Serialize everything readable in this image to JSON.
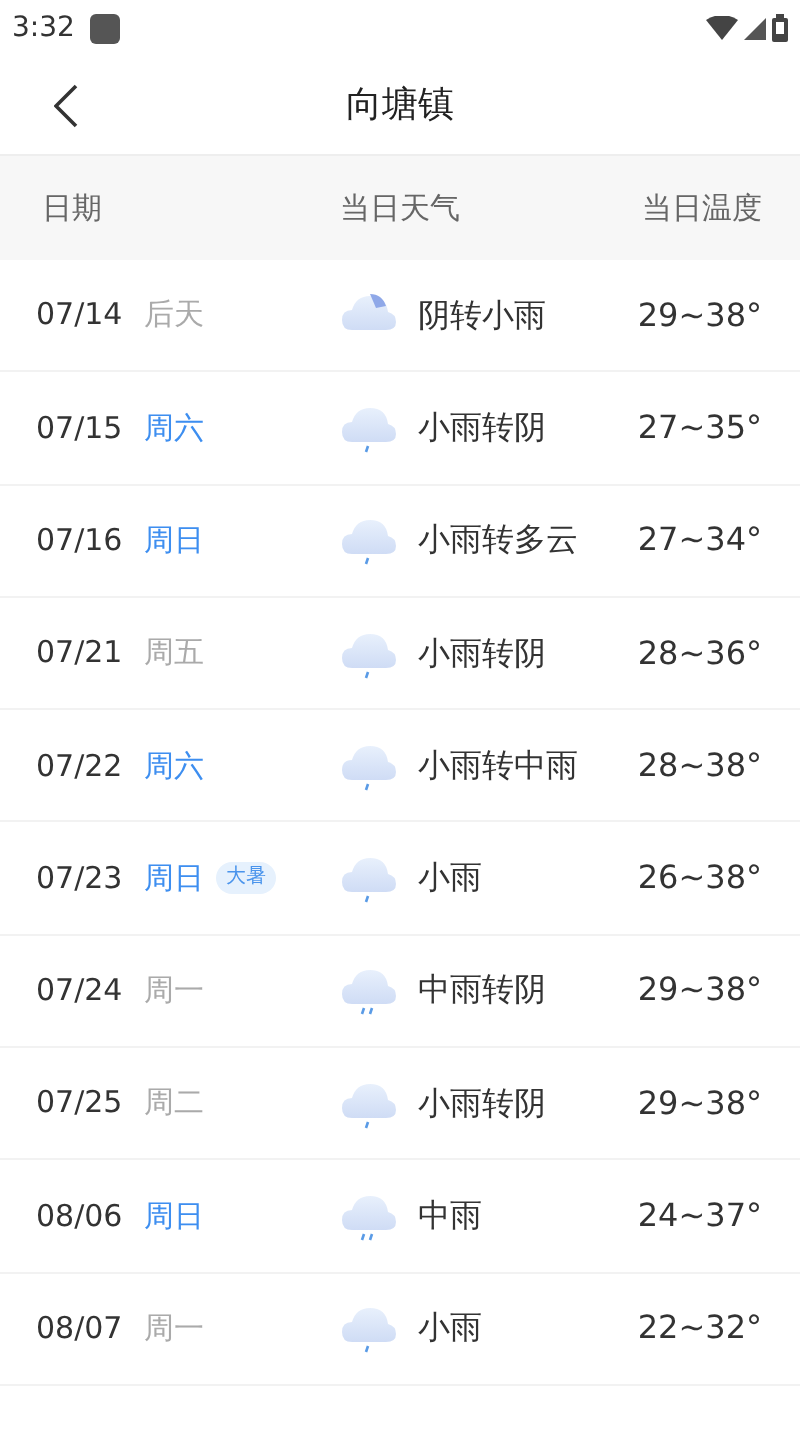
{
  "status_bar": {
    "time": "3:32"
  },
  "title_bar": {
    "title": "向塘镇"
  },
  "table": {
    "columns": [
      "日期",
      "当日天气",
      "当日温度"
    ],
    "rows": [
      {
        "date": "07/14",
        "day": "后天",
        "weekend": false,
        "kind": "cloudy",
        "weather": "阴转小雨",
        "temp": "29~38°"
      },
      {
        "date": "07/15",
        "day": "周六",
        "weekend": true,
        "kind": "light-rain",
        "weather": "小雨转阴",
        "temp": "27~35°"
      },
      {
        "date": "07/16",
        "day": "周日",
        "weekend": true,
        "kind": "light-rain",
        "weather": "小雨转多云",
        "temp": "27~34°"
      },
      {
        "date": "07/21",
        "day": "周五",
        "weekend": false,
        "kind": "light-rain",
        "weather": "小雨转阴",
        "temp": "28~36°"
      },
      {
        "date": "07/22",
        "day": "周六",
        "weekend": true,
        "kind": "light-rain",
        "weather": "小雨转中雨",
        "temp": "28~38°"
      },
      {
        "date": "07/23",
        "day": "周日",
        "weekend": true,
        "tag": "大暑",
        "kind": "light-rain",
        "weather": "小雨",
        "temp": "26~38°"
      },
      {
        "date": "07/24",
        "day": "周一",
        "weekend": false,
        "kind": "moderate-rain",
        "weather": "中雨转阴",
        "temp": "29~38°"
      },
      {
        "date": "07/25",
        "day": "周二",
        "weekend": false,
        "kind": "light-rain",
        "weather": "小雨转阴",
        "temp": "29~38°"
      },
      {
        "date": "08/06",
        "day": "周日",
        "weekend": true,
        "kind": "moderate-rain",
        "weather": "中雨",
        "temp": "24~37°"
      },
      {
        "date": "08/07",
        "day": "周一",
        "weekend": false,
        "kind": "light-rain",
        "weather": "小雨",
        "temp": "22~32°"
      }
    ]
  }
}
